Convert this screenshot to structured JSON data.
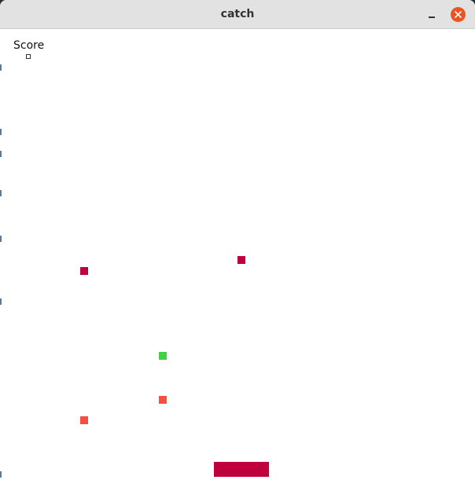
{
  "window": {
    "title": "catch"
  },
  "controls": {
    "minimize_icon": "minimize-icon",
    "close_icon": "close-icon",
    "close_color": "#e95420"
  },
  "game": {
    "score_label": "Score",
    "score_value": "",
    "paddle_color": "#c0003c",
    "falling_blocks": [
      {
        "color": "#c0003c"
      },
      {
        "color": "#c0003c"
      },
      {
        "color": "#44d044"
      },
      {
        "color": "#f44f40"
      },
      {
        "color": "#f44f40"
      }
    ]
  }
}
